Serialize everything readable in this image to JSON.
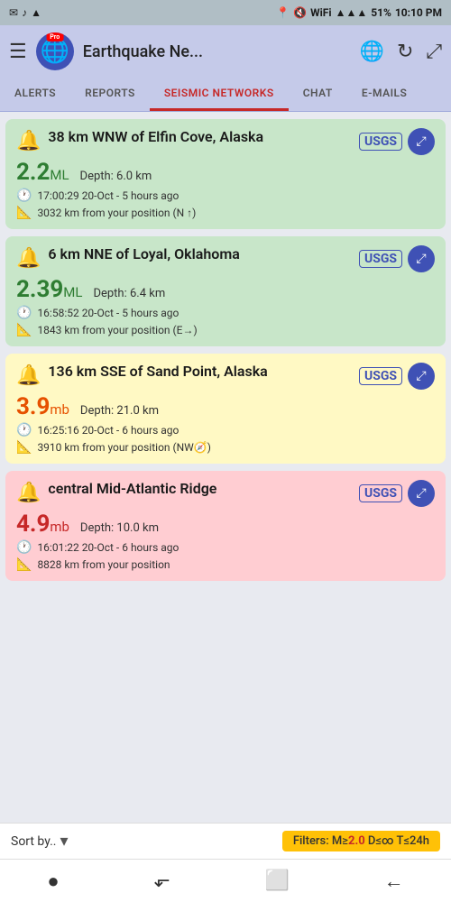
{
  "statusBar": {
    "leftIcons": [
      "✉",
      "🎵",
      "☁"
    ],
    "location": "📍",
    "wifi": "WiFi",
    "signal": "▲▲▲",
    "battery": "51%",
    "time": "10:10 PM"
  },
  "header": {
    "menuIcon": "☰",
    "logoEmoji": "🌐",
    "proBadge": "Pro",
    "title": "Earthquake Ne...",
    "globeIcon": "🌐",
    "refreshIcon": "↻",
    "expandIcon": "⤢"
  },
  "tabs": [
    {
      "label": "ALERTS",
      "active": false
    },
    {
      "label": "REPORTS",
      "active": false
    },
    {
      "label": "SEISMIC NETWORKS",
      "active": true
    },
    {
      "label": "CHAT",
      "active": false
    },
    {
      "label": "E-MAILS",
      "active": false
    }
  ],
  "earthquakes": [
    {
      "id": "eq1",
      "color": "green",
      "title": "38 km WNW of Elfin Cove, Alaska",
      "source": "USGS",
      "magnitude": "2.2",
      "magUnit": "ML",
      "magColor": "green-mag",
      "depth": "Depth: 6.0 km",
      "time": "17:00:29 20-Oct - 5 hours ago",
      "distance": "3032 km from your position (N ↑)"
    },
    {
      "id": "eq2",
      "color": "green",
      "title": "6 km NNE of Loyal, Oklahoma",
      "source": "USGS",
      "magnitude": "2.39",
      "magUnit": "ML",
      "magColor": "green-mag",
      "depth": "Depth: 6.4 km",
      "time": "16:58:52 20-Oct - 5 hours ago",
      "distance": "1843 km from your position (E→)"
    },
    {
      "id": "eq3",
      "color": "yellow",
      "title": "136 km SSE of Sand Point, Alaska",
      "source": "USGS",
      "magnitude": "3.9",
      "magUnit": "mb",
      "magColor": "orange-mag",
      "depth": "Depth: 21.0 km",
      "time": "16:25:16 20-Oct - 6 hours ago",
      "distance": "3910 km from your position (NW🧭)"
    },
    {
      "id": "eq4",
      "color": "red",
      "title": "central Mid-Atlantic Ridge",
      "source": "USGS",
      "magnitude": "4.9",
      "magUnit": "mb",
      "magColor": "red-mag",
      "depth": "Depth: 10.0 km",
      "time": "16:01:22 20-Oct - 6 hours ago",
      "distance": "8828 km from your position"
    }
  ],
  "sortBar": {
    "sortLabel": "Sort by..",
    "dropdownIcon": "▾",
    "filterText": "Filters: M≥",
    "filterMag": "2.0",
    "filterRest": " D≤∞ T≤24h"
  },
  "bottomNav": {
    "icons": [
      "●",
      "⬐",
      "⬜",
      "←"
    ]
  }
}
